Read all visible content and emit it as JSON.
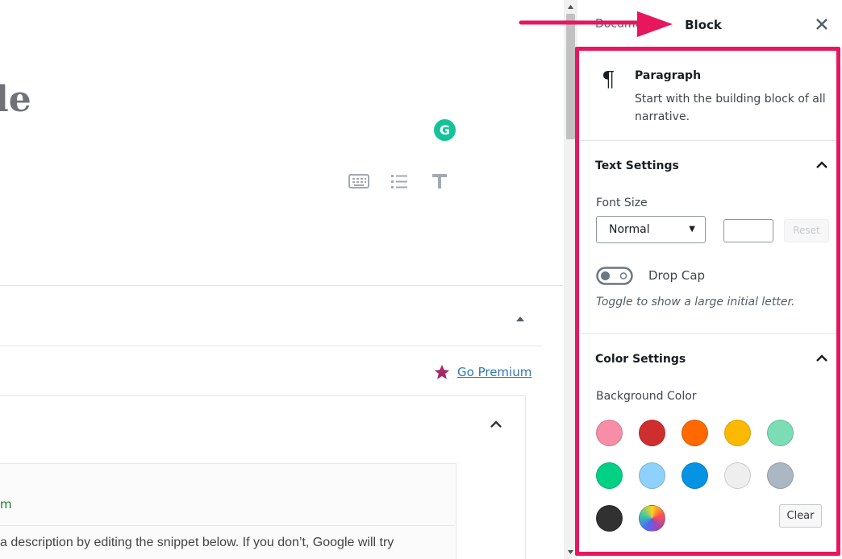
{
  "editor": {
    "title_fragment": "le",
    "grammarly_letter": "G",
    "go_premium": "Go Premium",
    "snippet_heading_fragment": "m",
    "snippet_description": "a description by editing the snippet below. If you don’t, Google will try"
  },
  "sidebar": {
    "tabs": {
      "document": "Document",
      "block": "Block"
    },
    "block": {
      "name": "Paragraph",
      "description": "Start with the building block of all narrative."
    },
    "text_settings": {
      "title": "Text Settings",
      "font_size_label": "Font Size",
      "font_size_value": "Normal",
      "reset_label": "Reset",
      "drop_cap_label": "Drop Cap",
      "drop_cap_help": "Toggle to show a large initial letter."
    },
    "color_settings": {
      "title": "Color Settings",
      "background_label": "Background Color",
      "clear_label": "Clear"
    }
  },
  "colors": {
    "accent": "#007cba",
    "annotation": "#e8175d",
    "swatches": [
      "#f78da7",
      "#cf2e2e",
      "#ff6900",
      "#fcb900",
      "#7bdcb5",
      "#00d084",
      "#8ed1fc",
      "#0693e3",
      "#eeeeee",
      "#abb8c3",
      "#313131",
      "gradient"
    ]
  },
  "icons": [
    "keyboard-icon",
    "list-icon",
    "text-icon",
    "pilcrow-icon",
    "close-icon",
    "chevron-up-icon",
    "star-icon",
    "toggle-icon"
  ]
}
